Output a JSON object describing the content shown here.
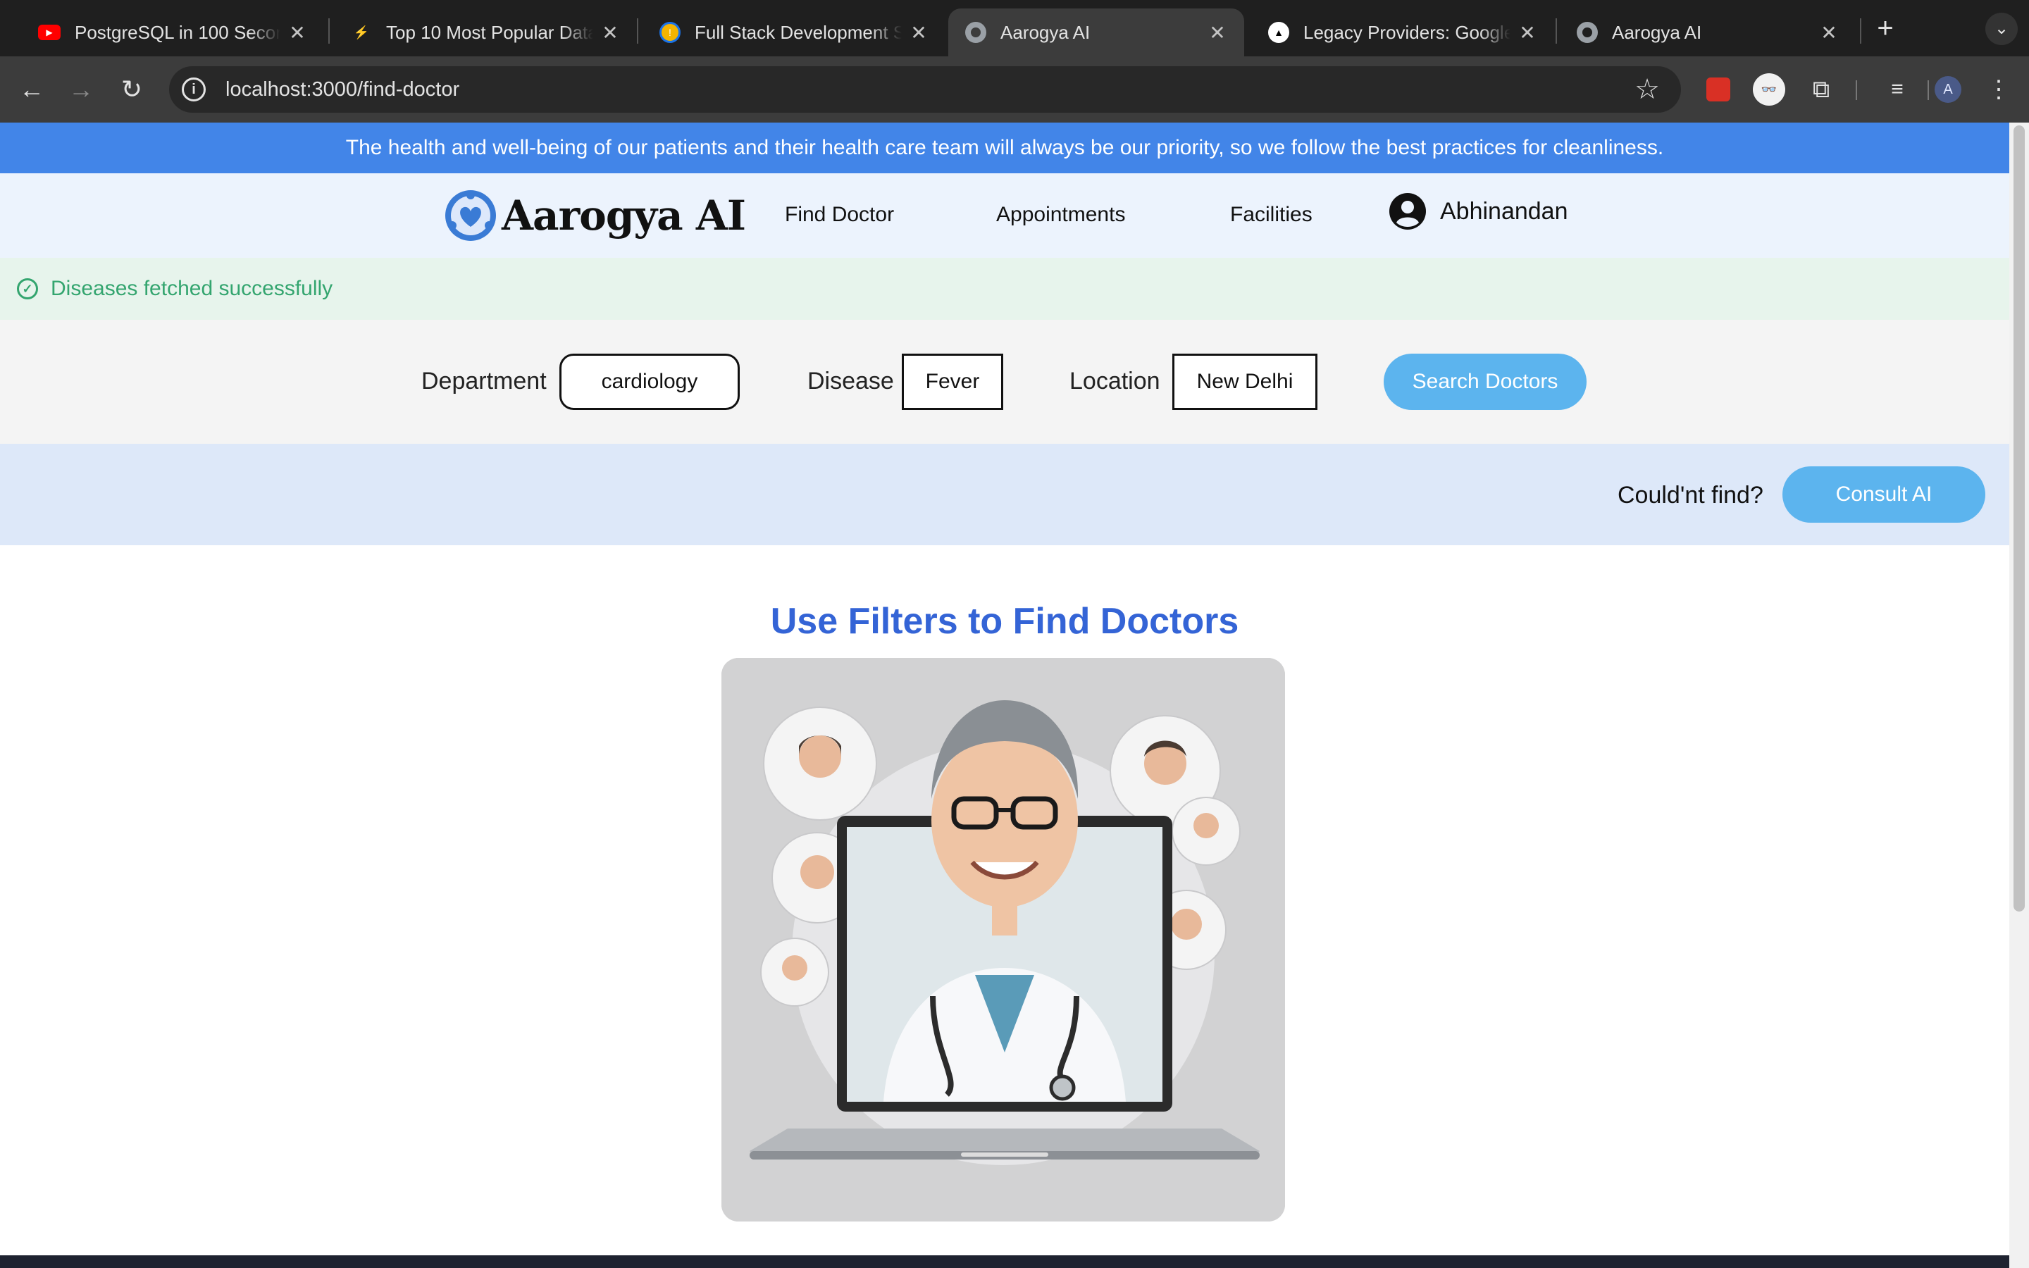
{
  "browser": {
    "tabs": [
      {
        "title": "PostgreSQL in 100 Seconds",
        "icon": "youtube-icon",
        "active": false
      },
      {
        "title": "Top 10 Most Popular Databases",
        "icon": "bolt-icon",
        "active": false
      },
      {
        "title": "Full Stack Development Sessions",
        "icon": "info-circle-icon",
        "active": false
      },
      {
        "title": "Aarogya AI",
        "icon": "globe-icon",
        "active": true
      },
      {
        "title": "Legacy Providers: Google",
        "icon": "triangle-logo-icon",
        "active": false
      },
      {
        "title": "Aarogya AI",
        "icon": "globe-icon",
        "active": false
      }
    ],
    "url": "localhost:3000/find-doctor",
    "profile_initial": "A"
  },
  "banner": {
    "text": "The health and well-being of our patients and their health care team will always be our priority, so we follow the best practices for cleanliness."
  },
  "nav": {
    "brand": "Aarogya AI",
    "links": [
      "Find Doctor",
      "Appointments",
      "Facilities"
    ],
    "user_name": "Abhinandan"
  },
  "toast": {
    "message": "Diseases fetched successfully"
  },
  "filters": {
    "department_label": "Department",
    "department_value": "cardiology",
    "disease_label": "Disease",
    "disease_value": "Fever",
    "location_label": "Location",
    "location_value": "New Delhi",
    "search_label": "Search Doctors"
  },
  "consult": {
    "prompt": "Could'nt find?",
    "button_label": "Consult AI"
  },
  "hero": {
    "title": "Use Filters to Find Doctors",
    "image_icon": "doctor-laptop-illustration"
  },
  "colors": {
    "banner": "#4285e8",
    "nav_bg": "#ecf3fd",
    "toast_text": "#34a56f",
    "button": "#5cb4ee",
    "title": "#3464d6"
  }
}
